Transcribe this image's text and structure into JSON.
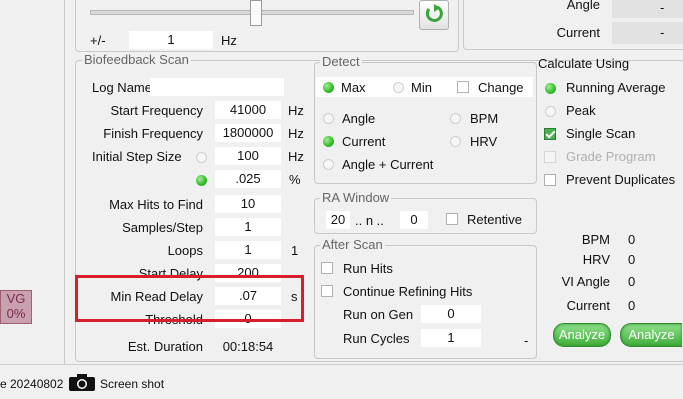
{
  "top": {
    "plus_minus": "+/-",
    "step_value": "1",
    "step_unit": "Hz",
    "angle_label": "Angle",
    "angle_value": "-",
    "current_label": "Current",
    "current_value": "-"
  },
  "scan": {
    "title": "Biofeedback Scan",
    "log_name_label": "Log Name",
    "log_name_value": "",
    "rows": {
      "start_freq": {
        "label": "Start Frequency",
        "value": "41000",
        "unit": "Hz"
      },
      "finish_freq": {
        "label": "Finish Frequency",
        "value": "1800000",
        "unit": "Hz"
      },
      "step_size": {
        "label": "Initial Step Size",
        "value": "100",
        "unit": "Hz"
      },
      "step_pct": {
        "value": ".025",
        "unit": "%"
      },
      "max_hits": {
        "label": "Max Hits to Find",
        "value": "10"
      },
      "samples": {
        "label": "Samples/Step",
        "value": "1"
      },
      "loops": {
        "label": "Loops",
        "value": "1",
        "extra": "1"
      },
      "start_delay": {
        "label": "Start Delay",
        "value": "200"
      },
      "read_delay": {
        "label": "Min  Read Delay",
        "value": ".07",
        "unit": "s"
      },
      "threshold": {
        "label": "Threshold",
        "value": "0"
      },
      "duration": {
        "label": "Est. Duration",
        "value": "00:18:54"
      }
    }
  },
  "detect": {
    "title": "Detect",
    "max": "Max",
    "min": "Min",
    "change": "Change",
    "angle": "Angle",
    "bpm": "BPM",
    "current": "Current",
    "hrv": "HRV",
    "angle_current": "Angle + Current"
  },
  "ra_window": {
    "title": "RA Window",
    "from": "20",
    "sep": ".. n ..",
    "to": "0",
    "retentive": "Retentive"
  },
  "after_scan": {
    "title": "After Scan",
    "run_hits": "Run Hits",
    "continue_refining": "Continue Refining Hits",
    "run_on_gen_label": "Run on Gen",
    "run_on_gen_value": "0",
    "run_cycles_label": "Run Cycles",
    "run_cycles_value": "1",
    "dash": "-"
  },
  "calc": {
    "title": "Calculate Using",
    "running_average": "Running Average",
    "peak": "Peak",
    "single_scan": "Single Scan",
    "grade_program": "Grade Program",
    "prevent_duplicates": "Prevent Duplicates"
  },
  "stats": {
    "bpm_label": "BPM",
    "bpm_value": "0",
    "hrv_label": "HRV",
    "hrv_value": "0",
    "vi_angle_label": "VI Angle",
    "vi_angle_value": "0",
    "current_label": "Current",
    "current_value": "0",
    "analyze1": "Analyze",
    "analyze2": "Analyze"
  },
  "vg": {
    "line1": "VG",
    "line2": "0%"
  },
  "status": {
    "date_text": "e 20240802",
    "screenshot_label": "Screen shot"
  },
  "colors": {
    "highlight": "#d81e2a",
    "radio_on": "#3cbe32",
    "analyze": "#4cb84a"
  }
}
